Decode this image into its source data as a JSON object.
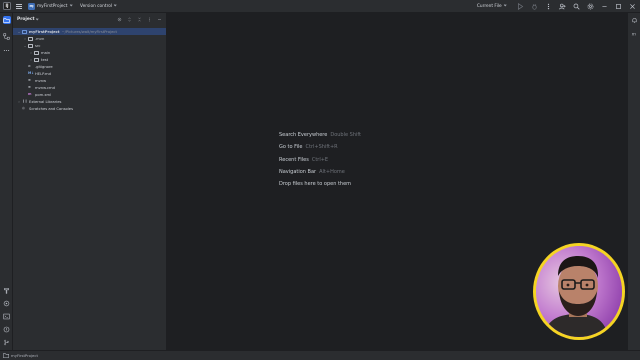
{
  "titlebar": {
    "logo_letter": "IJ",
    "project_badge": "MJ",
    "project_name": "myFirstProject",
    "vcs_label": "Version control",
    "run_config": "Current File"
  },
  "panel": {
    "title": "Project",
    "tree": [
      {
        "depth": 0,
        "arrow": "v",
        "icon": "folder-blue",
        "label": "myFirstProject",
        "path": "~/Pictures/walt/myFirstProject",
        "selected": true
      },
      {
        "depth": 1,
        "arrow": ">",
        "icon": "folder",
        "label": ".mvn"
      },
      {
        "depth": 1,
        "arrow": "v",
        "icon": "folder",
        "label": "src"
      },
      {
        "depth": 2,
        "arrow": ">",
        "icon": "folder",
        "label": "main"
      },
      {
        "depth": 2,
        "arrow": ">",
        "icon": "folder",
        "label": "test"
      },
      {
        "depth": 1,
        "arrow": "",
        "icon": "gitignore",
        "label": ".gitignore"
      },
      {
        "depth": 1,
        "arrow": "",
        "icon": "md",
        "label": "HELP.md"
      },
      {
        "depth": 1,
        "arrow": "",
        "icon": "file",
        "label": "mvnw"
      },
      {
        "depth": 1,
        "arrow": "",
        "icon": "file",
        "label": "mvnw.cmd"
      },
      {
        "depth": 1,
        "arrow": "",
        "icon": "maven",
        "label": "pom.xml"
      },
      {
        "depth": 0,
        "arrow": ">",
        "icon": "libs",
        "label": "External Libraries"
      },
      {
        "depth": 0,
        "arrow": "",
        "icon": "scratch",
        "label": "Scratches and Consoles"
      }
    ]
  },
  "editor": {
    "hints": [
      {
        "label": "Search Everywhere",
        "shortcut": "Double Shift"
      },
      {
        "label": "Go to File",
        "shortcut": "Ctrl+Shift+R"
      },
      {
        "label": "Recent Files",
        "shortcut": "Ctrl+E"
      },
      {
        "label": "Navigation Bar",
        "shortcut": "Alt+Home"
      },
      {
        "label": "Drop files here to open them",
        "shortcut": ""
      }
    ]
  },
  "statusbar": {
    "breadcrumb": "myFirstProject"
  },
  "colors": {
    "accent": "#3574f0",
    "selection": "#2e436e",
    "panel_bg": "#2b2d30",
    "editor_bg": "#1e1f22",
    "webcam_ring": "#f5d423"
  }
}
